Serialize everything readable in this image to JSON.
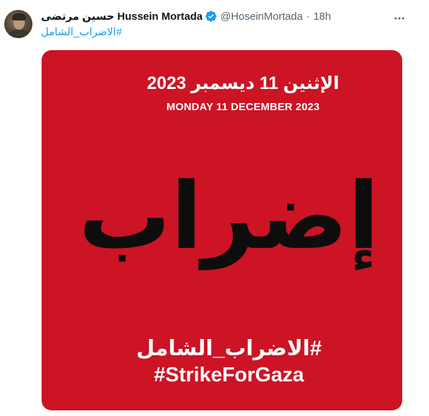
{
  "tweet": {
    "display_name": "حسين مرتضى Hussein Mortada",
    "handle": "@HoseinMortada",
    "separator": "·",
    "time": "18h",
    "text": "#الاضراب_الشامل",
    "verified_icon": "verified-badge-icon",
    "more_icon": "more-options-icon",
    "colors": {
      "name": "#0f1419",
      "meta": "#536471",
      "link": "#1d9bf0",
      "verified": "#1d9bf0"
    }
  },
  "media": {
    "background_color": "#cc1425",
    "date_arabic": "الإثنين 11 ديسمبر 2023",
    "date_english": "MONDAY 11 DECEMBER 2023",
    "headline": "إضراب",
    "hashtag_arabic": "#الاضراب_الشامل",
    "hashtag_english": "#StrikeForGaza"
  }
}
